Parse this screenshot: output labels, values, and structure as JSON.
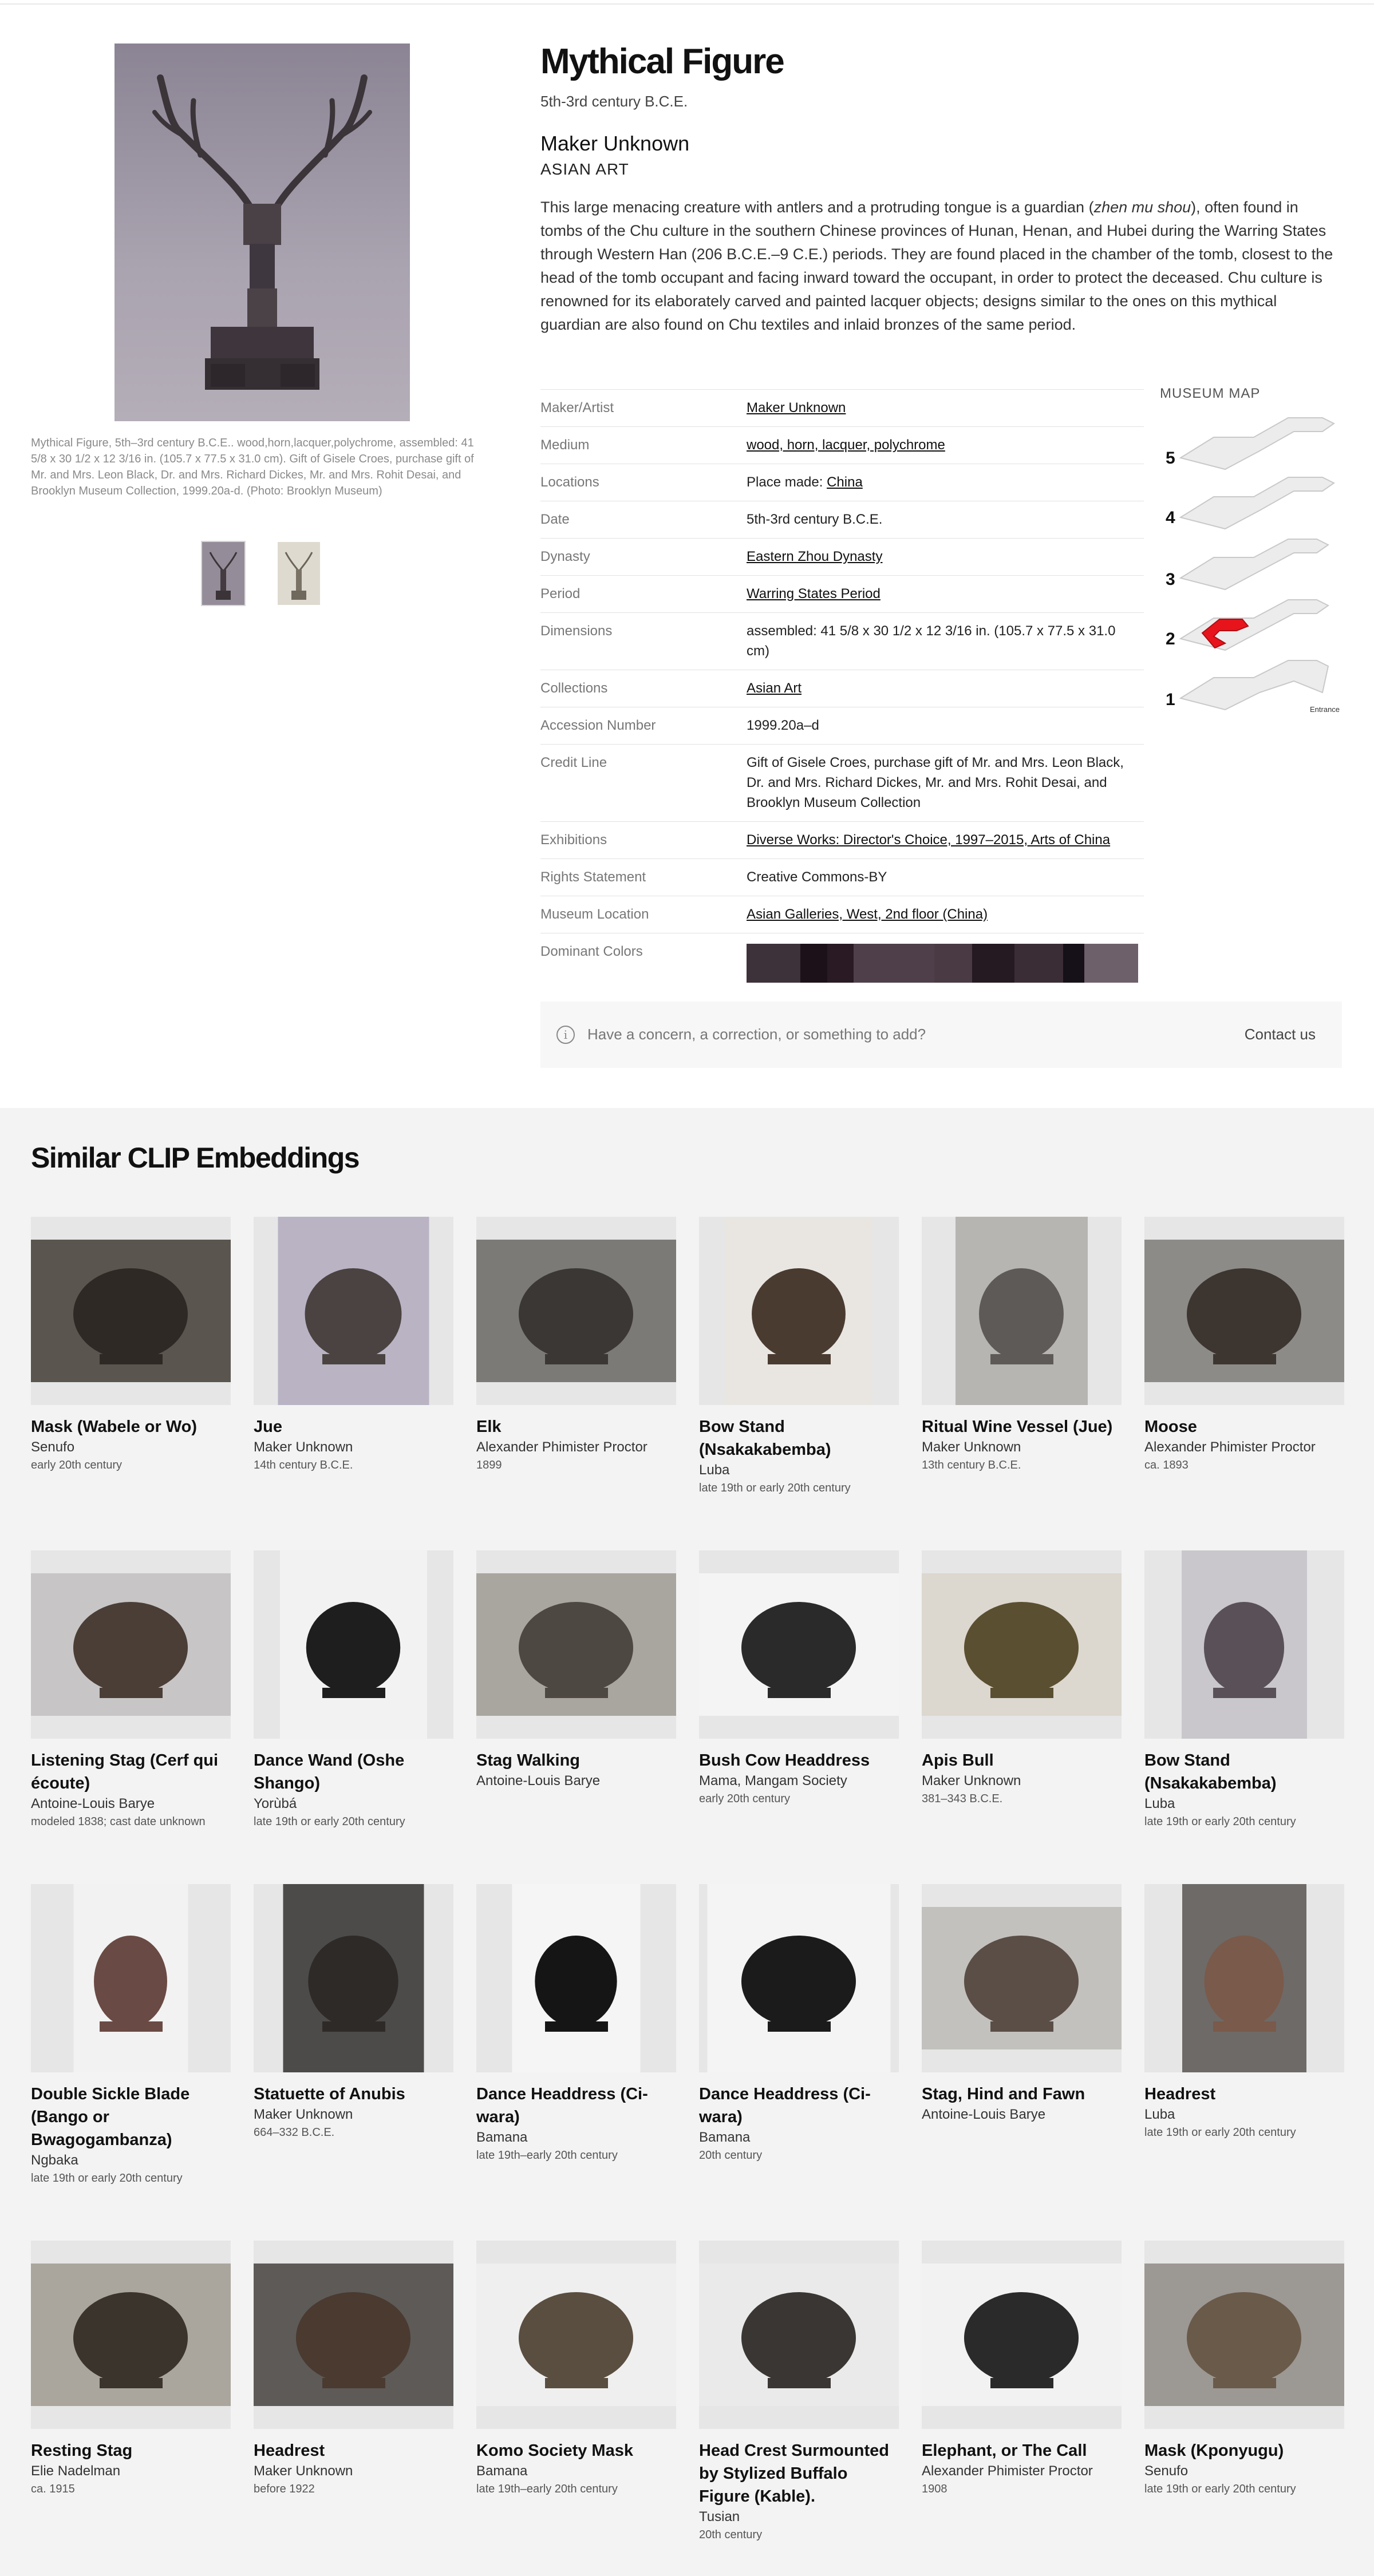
{
  "object": {
    "title": "Mythical Figure",
    "date": "5th-3rd century B.C.E.",
    "maker": "Maker Unknown",
    "department": "ASIAN ART",
    "description": "This large menacing creature with antlers and a protruding tongue is a guardian (zhen mu shou), often found in tombs of the Chu culture in the southern Chinese provinces of Hunan, Henan, and Hubei during the Warring States through Western Han (206 B.C.E.–9 C.E.) periods. They are found placed in the chamber of the tomb, closest to the head of the tomb occupant and facing inward toward the occupant, in order to protect the deceased. Chu culture is renowned for its elaborately carved and painted lacquer objects; designs similar to the ones on this mythical guardian are also found on Chu textiles and inlaid bronzes of the same period.",
    "photo_caption": "Mythical Figure, 5th–3rd century B.C.E.. wood,horn,lacquer,polychrome, assembled: 41 5/8 x 30 1/2 x 12 3/16 in. (105.7 x 77.5 x 31.0 cm). Gift of Gisele Croes, purchase gift of Mr. and Mrs. Leon Black, Dr. and Mrs. Richard Dickes, Mr. and Mrs. Rohit Desai, and Brooklyn Museum Collection, 1999.20a-d. (Photo: Brooklyn Museum)"
  },
  "details": {
    "maker_label": "Maker/Artist",
    "maker_value": "Maker Unknown",
    "medium_label": "Medium",
    "medium_value": "wood, horn, lacquer, polychrome",
    "locations_label": "Locations",
    "locations_prefix": "Place made: ",
    "locations_value": "China",
    "date_label": "Date",
    "date_value": "5th-3rd century B.C.E.",
    "dynasty_label": "Dynasty",
    "dynasty_value": "Eastern Zhou Dynasty",
    "period_label": "Period",
    "period_value": "Warring States Period",
    "dimensions_label": "Dimensions",
    "dimensions_value": "assembled: 41 5/8 x 30 1/2 x 12 3/16 in. (105.7 x 77.5 x 31.0 cm)",
    "collections_label": "Collections",
    "collections_value": "Asian Art",
    "accession_label": "Accession Number",
    "accession_value": "1999.20a–d",
    "credit_label": "Credit Line",
    "credit_value": "Gift of Gisele Croes, purchase gift of Mr. and Mrs. Leon Black, Dr. and Mrs. Richard Dickes, Mr. and Mrs. Rohit Desai, and Brooklyn Museum Collection",
    "exhibitions_label": "Exhibitions",
    "exhibitions_value": "Diverse Works: Director's Choice, 1997–2015, Arts of China",
    "rights_label": "Rights Statement",
    "rights_value": "Creative Commons-BY",
    "location_label": "Museum Location",
    "location_value": "Asian Galleries, West, 2nd floor (China)",
    "colors_label": "Dominant Colors",
    "dominant_colors": [
      "#3d313a",
      "#1c1119",
      "#2a1a23",
      "#4e3f4a",
      "#4a3a44",
      "#251a21",
      "#3b2d36",
      "#161018",
      "#6e606a"
    ],
    "dominant_color_shares": [
      0.1,
      0.05,
      0.05,
      0.15,
      0.07,
      0.08,
      0.09,
      0.04,
      0.1
    ]
  },
  "map": {
    "title": "MUSEUM MAP",
    "floors": [
      "5",
      "4",
      "3",
      "2",
      "1"
    ],
    "highlight_floor": "2",
    "highlight_color": "#e8141c",
    "entrance_label": "Entrance"
  },
  "concern": {
    "icon": "info-icon",
    "text": "Have a concern, a correction, or something to add?",
    "contact_label": "Contact us"
  },
  "similar": {
    "title": "Similar CLIP Embeddings",
    "items": [
      {
        "title": "Mask (Wabele or Wo)",
        "maker": "Senufo",
        "date": "early 20th century"
      },
      {
        "title": "Jue",
        "maker": "Maker Unknown",
        "date": "14th century B.C.E."
      },
      {
        "title": "Elk",
        "maker": "Alexander Phimister Proctor",
        "date": "1899"
      },
      {
        "title": "Bow Stand (Nsakakabemba)",
        "maker": "Luba",
        "date": "late 19th or early 20th century"
      },
      {
        "title": "Ritual Wine Vessel (Jue)",
        "maker": "Maker Unknown",
        "date": "13th century B.C.E."
      },
      {
        "title": "Moose",
        "maker": "Alexander Phimister Proctor",
        "date": "ca. 1893"
      },
      {
        "title": "Listening Stag (Cerf qui écoute)",
        "maker": "Antoine-Louis Barye",
        "date": "modeled 1838; cast date unknown"
      },
      {
        "title": "Dance Wand (Oshe Shango)",
        "maker": "Yorùbá",
        "date": "late 19th or early 20th century"
      },
      {
        "title": "Stag Walking",
        "maker": "Antoine-Louis Barye",
        "date": ""
      },
      {
        "title": "Bush Cow Headdress",
        "maker": "Mama, Mangam Society",
        "date": "early 20th century"
      },
      {
        "title": "Apis Bull",
        "maker": "Maker Unknown",
        "date": "381–343 B.C.E."
      },
      {
        "title": "Bow Stand (Nsakakabemba)",
        "maker": "Luba",
        "date": "late 19th or early 20th century"
      },
      {
        "title": "Double Sickle Blade (Bango or Bwagogambanza)",
        "maker": "Ngbaka",
        "date": "late 19th or early 20th century"
      },
      {
        "title": "Statuette of Anubis",
        "maker": "Maker Unknown",
        "date": "664–332 B.C.E."
      },
      {
        "title": "Dance Headdress (Ci-wara)",
        "maker": "Bamana",
        "date": "late 19th–early 20th century"
      },
      {
        "title": "Dance Headdress (Ci-wara)",
        "maker": "Bamana",
        "date": "20th century"
      },
      {
        "title": "Stag, Hind and Fawn",
        "maker": "Antoine-Louis Barye",
        "date": ""
      },
      {
        "title": "Headrest",
        "maker": "Luba",
        "date": "late 19th or early 20th century"
      },
      {
        "title": "Resting Stag",
        "maker": "Elie Nadelman",
        "date": "ca. 1915"
      },
      {
        "title": "Headrest",
        "maker": "Maker Unknown",
        "date": "before 1922"
      },
      {
        "title": "Komo Society Mask",
        "maker": "Bamana",
        "date": "late 19th–early 20th century"
      },
      {
        "title": "Head Crest Surmounted by Stylized Buffalo Figure (Kable).",
        "maker": "Tusian",
        "date": "20th century"
      },
      {
        "title": "Elephant, or The Call",
        "maker": "Alexander Phimister Proctor",
        "date": "1908"
      },
      {
        "title": "Mask (Kponyugu)",
        "maker": "Senufo",
        "date": "late 19th or early 20th century"
      }
    ]
  }
}
